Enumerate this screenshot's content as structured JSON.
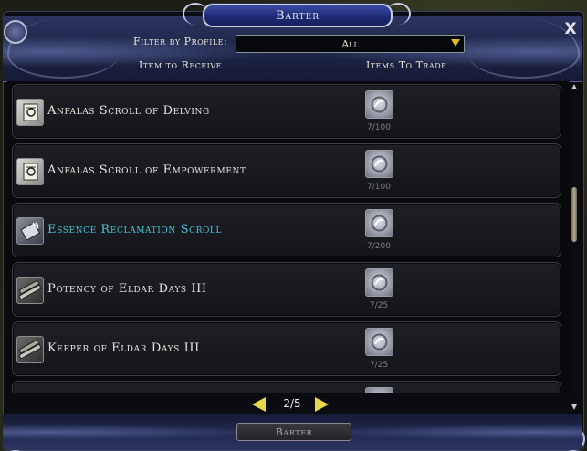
{
  "window": {
    "title": "Barter",
    "close_label": "X"
  },
  "filter": {
    "label": "Filter by Profile:",
    "selected": "All"
  },
  "columns": {
    "receive": "Item to Receive",
    "trade": "Items To Trade"
  },
  "rows": [
    {
      "name": "Anfalas Scroll of Delving",
      "icon": "scroll-rune-icon",
      "trade_icon": "silver-token-icon",
      "cost": "7/100",
      "highlighted": false
    },
    {
      "name": "Anfalas Scroll of Empowerment",
      "icon": "scroll-rune-icon",
      "trade_icon": "silver-token-icon",
      "cost": "7/100",
      "highlighted": false
    },
    {
      "name": "Essence Reclamation Scroll",
      "icon": "reclamation-scroll-icon",
      "trade_icon": "silver-token-icon",
      "cost": "7/200",
      "highlighted": true
    },
    {
      "name": "Potency of Eldar Days III",
      "icon": "rolled-scroll-icon",
      "trade_icon": "silver-token-icon",
      "cost": "7/25",
      "highlighted": false
    },
    {
      "name": "Keeper of Eldar Days III",
      "icon": "rolled-scroll-icon",
      "trade_icon": "silver-token-icon",
      "cost": "7/25",
      "highlighted": false
    }
  ],
  "pager": {
    "text": "2/5"
  },
  "footer": {
    "barter_label": "Barter"
  },
  "colors": {
    "highlight": "#4cc4d6",
    "arrow": "#e6d84a",
    "panel": "#1d2448"
  }
}
